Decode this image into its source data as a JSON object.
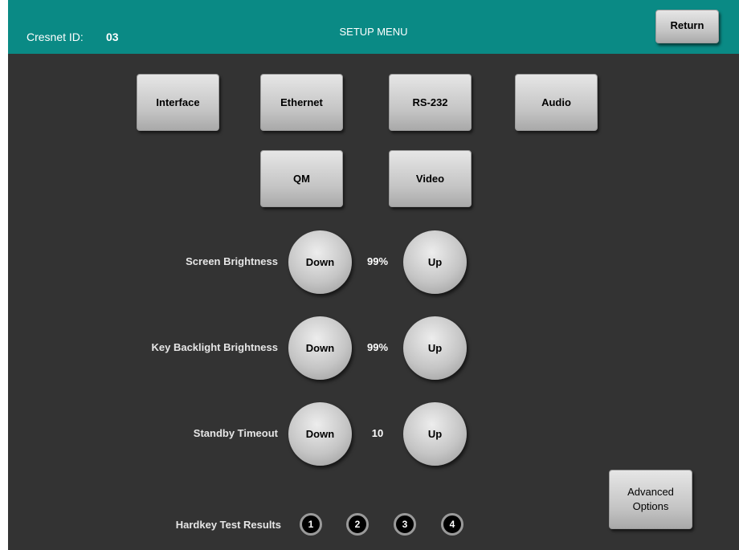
{
  "header": {
    "cresnet_label": "Cresnet ID:",
    "cresnet_value": "03",
    "title": "SETUP MENU",
    "return_label": "Return"
  },
  "menu": {
    "interface": "Interface",
    "ethernet": "Ethernet",
    "rs232": "RS-232",
    "audio": "Audio",
    "qm": "QM",
    "video": "Video"
  },
  "settings": {
    "screen_brightness": {
      "label": "Screen Brightness",
      "down": "Down",
      "value": "99%",
      "up": "Up"
    },
    "key_backlight": {
      "label": "Key Backlight Brightness",
      "down": "Down",
      "value": "99%",
      "up": "Up"
    },
    "standby_timeout": {
      "label": "Standby Timeout",
      "down": "Down",
      "value": "10",
      "up": "Up"
    }
  },
  "hardkey": {
    "label": "Hardkey Test Results",
    "keys": [
      "1",
      "2",
      "3",
      "4"
    ]
  },
  "advanced": {
    "line1": "Advanced",
    "line2": "Options"
  },
  "colors": {
    "header": "#0a8a85",
    "background": "#333333"
  }
}
